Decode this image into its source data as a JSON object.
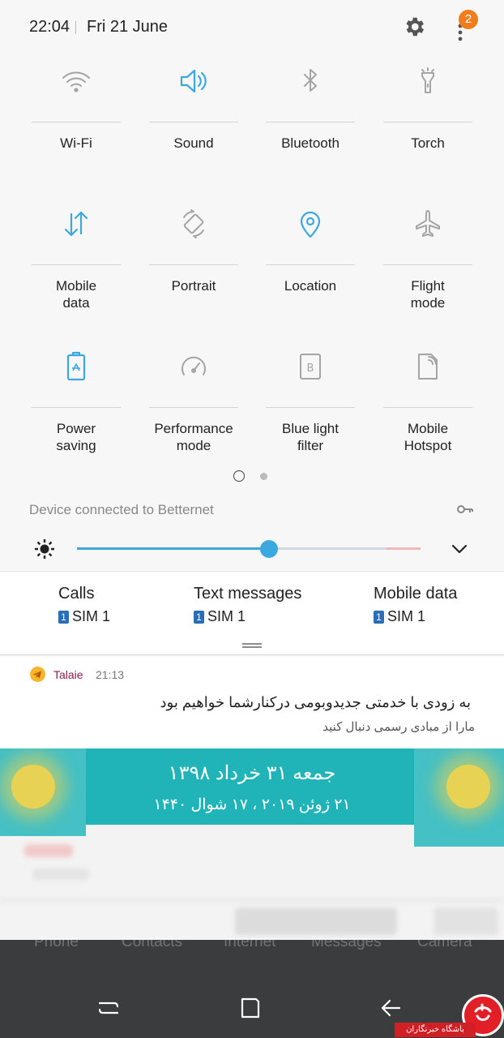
{
  "status_bar": {
    "time": "22:04",
    "date": "Fri 21 June",
    "notification_count": "2"
  },
  "quick_settings": [
    {
      "label": "Wi-Fi",
      "icon": "wifi-icon",
      "active": false
    },
    {
      "label": "Sound",
      "icon": "sound-icon",
      "active": true
    },
    {
      "label": "Bluetooth",
      "icon": "bluetooth-icon",
      "active": false
    },
    {
      "label": "Torch",
      "icon": "torch-icon",
      "active": false
    },
    {
      "label": "Mobile\ndata",
      "icon": "mobile-data-icon",
      "active": true
    },
    {
      "label": "Portrait",
      "icon": "rotation-icon",
      "active": false
    },
    {
      "label": "Location",
      "icon": "location-icon",
      "active": true
    },
    {
      "label": "Flight\nmode",
      "icon": "airplane-icon",
      "active": false
    },
    {
      "label": "Power\nsaving",
      "icon": "battery-icon",
      "active": true
    },
    {
      "label": "Performance\nmode",
      "icon": "speedometer-icon",
      "active": false
    },
    {
      "label": "Blue light\nfilter",
      "icon": "blue-light-filter-icon",
      "active": false
    },
    {
      "label": "Mobile\nHotspot",
      "icon": "hotspot-icon",
      "active": false
    }
  ],
  "vpn_status": "Device connected to Betternet",
  "brightness": {
    "level": 0.56
  },
  "sim_prefs": [
    {
      "title": "Calls",
      "sim_number": "1",
      "sim_label": "SIM 1"
    },
    {
      "title": "Text messages",
      "sim_number": "1",
      "sim_label": "SIM 1"
    },
    {
      "title": "Mobile data",
      "sim_number": "1",
      "sim_label": "SIM 1"
    }
  ],
  "notification": {
    "app": "Talaie",
    "time": "21:13",
    "title": "به زودی با خدمتی جدیدوبومی درکنارشما خواهیم بود",
    "body": "مارا از مبادی رسمی دنبال کنید"
  },
  "calendar_widget": {
    "line1": "جمعه ۳۱ خرداد ۱۳۹۸",
    "line2": "۲۱ ژوئن ۲۰۱۹ ، ۱۷ شوال ۱۴۴۰"
  },
  "dock": [
    "Phone",
    "Contacts",
    "Internet",
    "Messages",
    "Camera"
  ],
  "watermark": "باشگاه خبرنگاران",
  "colors": {
    "accent": "#3ba9e0",
    "inactive_icon": "#9a9a9a",
    "badge": "#f07c1b",
    "calendar": "#20b4b8"
  }
}
